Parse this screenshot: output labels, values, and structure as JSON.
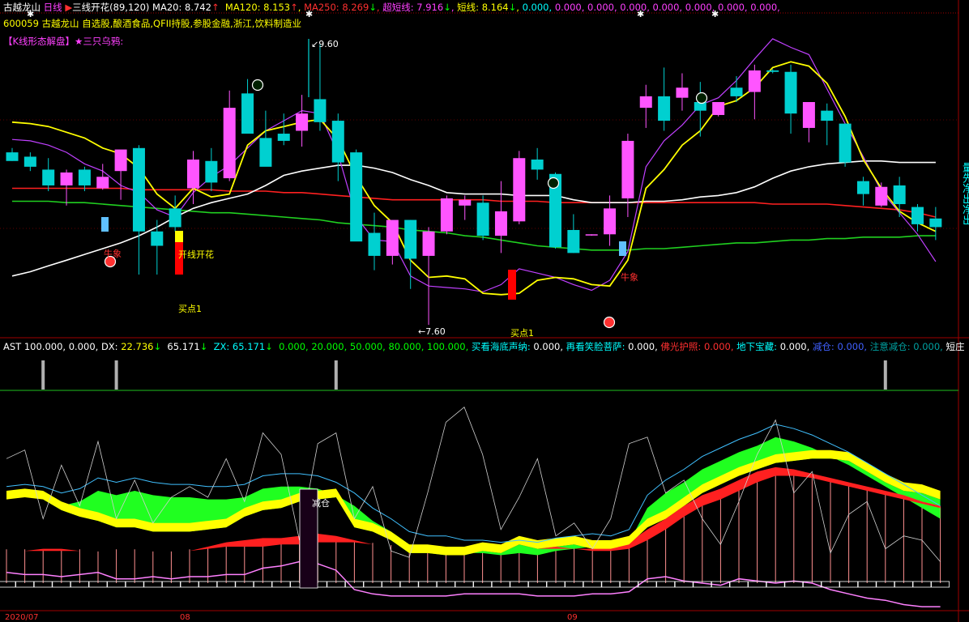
{
  "header1": {
    "name": "古越龙山",
    "period": "日线",
    "indicator": "三线开花",
    "params": "(89,120)",
    "ma20_label": "MA20:",
    "ma20": "8.742",
    "ma120_label": "MA120:",
    "ma120": "8.153",
    "ma250_label": "MA250:",
    "ma250": "8.269",
    "super_short_label": "超短线:",
    "super_short": "7.916",
    "short_label": "短线:",
    "short": "8.164",
    "tail_yellow": "0.000,",
    "tail_magenta": "0.000, 0.000, 0.000, 0.000, 0.000, 0.000, 0.000,"
  },
  "header2": {
    "code": "600059",
    "name": "古越龙山",
    "concepts": "自选股,酿酒食品,QFII持股,参股金融,浙江,饮料制造业"
  },
  "header3": {
    "bracket": "【K线形态解盘】",
    "pattern": "★三只乌鸦:"
  },
  "header4": {
    "p1": "AST 100.000, 0.000, DX:",
    "dx": "22.736",
    "dx2": "65.171",
    "zx_label": "ZX:",
    "zx": "65.171",
    "green_vals": "0.000, 20.000, 50.000, 80.000, 100.000,",
    "t1": "买看海底声纳:",
    "v1": "0.000,",
    "t2": "再看笑脸菩萨:",
    "v2": "0.000,",
    "t3": "佛光护照:",
    "v3": "0.000,",
    "t4": "地下宝藏:",
    "v4": "0.000,",
    "t5": "减仓:",
    "v5": "0.000,",
    "t6": "注意减仓:",
    "v6": "0.000,",
    "t7": "短庄"
  },
  "annotations": {
    "high": "9.60",
    "low": "7.60",
    "kaihua": "开线开花",
    "buy1a": "买点1",
    "buy1b": "买点1",
    "niu1": "牛象",
    "niu2": "牛象",
    "jiancang": "减仓",
    "right_edge": "量先净出净出",
    "bottom_left": "2020/07",
    "bottom_mid1": "08",
    "bottom_mid2": "09"
  },
  "colors": {
    "bull": "#ff55ff",
    "bear": "#00d0d0",
    "ma20": "#ffffff",
    "ma120": "#ff2020",
    "ma250": "#20d020",
    "super_short": "#ffff00",
    "short": "#c040ff",
    "white_text": "#ffffff",
    "yellow_text": "#ffff00",
    "magenta_text": "#ff40ff",
    "cyan_text": "#00ffff",
    "green_text": "#00ff00",
    "red_text": "#ff3030",
    "blue_text": "#4060ff"
  },
  "chart_data": [
    {
      "type": "candlestick",
      "ylim": [
        7.6,
        9.6
      ],
      "candles": [
        {
          "o": 8.85,
          "h": 8.88,
          "l": 8.79,
          "c": 8.79
        },
        {
          "o": 8.82,
          "h": 8.85,
          "l": 8.72,
          "c": 8.75
        },
        {
          "o": 8.73,
          "h": 8.81,
          "l": 8.58,
          "c": 8.62
        },
        {
          "o": 8.62,
          "h": 8.73,
          "l": 8.48,
          "c": 8.71
        },
        {
          "o": 8.73,
          "h": 8.75,
          "l": 8.58,
          "c": 8.62
        },
        {
          "o": 8.6,
          "h": 8.77,
          "l": 8.59,
          "c": 8.68
        },
        {
          "o": 8.72,
          "h": 8.8,
          "l": 8.52,
          "c": 8.87
        },
        {
          "o": 8.88,
          "h": 8.9,
          "l": 8.0,
          "c": 8.3
        },
        {
          "o": 8.3,
          "h": 8.38,
          "l": 8.0,
          "c": 8.2
        },
        {
          "o": 8.46,
          "h": 8.55,
          "l": 8.3,
          "c": 8.33
        },
        {
          "o": 8.6,
          "h": 8.86,
          "l": 8.49,
          "c": 8.8
        },
        {
          "o": 8.79,
          "h": 8.88,
          "l": 8.58,
          "c": 8.64
        },
        {
          "o": 8.67,
          "h": 9.28,
          "l": 8.65,
          "c": 9.16
        },
        {
          "o": 9.26,
          "h": 9.36,
          "l": 8.99,
          "c": 8.98
        },
        {
          "o": 8.95,
          "h": 9.14,
          "l": 8.8,
          "c": 8.75
        },
        {
          "o": 8.98,
          "h": 9.12,
          "l": 8.9,
          "c": 8.93
        },
        {
          "o": 9.0,
          "h": 9.25,
          "l": 8.89,
          "c": 9.12
        },
        {
          "o": 9.22,
          "h": 9.6,
          "l": 9.0,
          "c": 9.06
        },
        {
          "o": 9.07,
          "h": 9.12,
          "l": 8.65,
          "c": 8.78
        },
        {
          "o": 8.85,
          "h": 8.87,
          "l": 8.25,
          "c": 8.23
        },
        {
          "o": 8.29,
          "h": 8.43,
          "l": 8.03,
          "c": 8.13
        },
        {
          "o": 8.13,
          "h": 8.37,
          "l": 8.07,
          "c": 8.38
        },
        {
          "o": 8.38,
          "h": 8.38,
          "l": 7.9,
          "c": 8.11
        },
        {
          "o": 8.13,
          "h": 8.33,
          "l": 7.65,
          "c": 8.3
        },
        {
          "o": 8.3,
          "h": 8.55,
          "l": 8.28,
          "c": 8.53
        },
        {
          "o": 8.48,
          "h": 8.55,
          "l": 8.38,
          "c": 8.52
        },
        {
          "o": 8.5,
          "h": 8.55,
          "l": 8.24,
          "c": 8.27
        },
        {
          "o": 8.27,
          "h": 8.65,
          "l": 8.15,
          "c": 8.44
        },
        {
          "o": 8.37,
          "h": 8.86,
          "l": 8.35,
          "c": 8.81
        },
        {
          "o": 8.8,
          "h": 8.88,
          "l": 8.66,
          "c": 8.73
        },
        {
          "o": 8.7,
          "h": 8.71,
          "l": 8.18,
          "c": 8.19
        },
        {
          "o": 8.31,
          "h": 8.42,
          "l": 8.15,
          "c": 8.15
        },
        {
          "o": 8.28,
          "h": 8.28,
          "l": 8.27,
          "c": 8.28
        },
        {
          "o": 8.28,
          "h": 8.55,
          "l": 8.2,
          "c": 8.46
        },
        {
          "o": 8.53,
          "h": 8.98,
          "l": 8.4,
          "c": 8.93
        },
        {
          "o": 9.16,
          "h": 9.32,
          "l": 9.02,
          "c": 9.24
        },
        {
          "o": 9.24,
          "h": 9.44,
          "l": 9.0,
          "c": 9.07
        },
        {
          "o": 9.23,
          "h": 9.4,
          "l": 9.14,
          "c": 9.3
        },
        {
          "o": 9.2,
          "h": 9.34,
          "l": 8.96,
          "c": 9.14
        },
        {
          "o": 9.11,
          "h": 9.2,
          "l": 9.1,
          "c": 9.2
        },
        {
          "o": 9.3,
          "h": 9.38,
          "l": 9.2,
          "c": 9.24
        },
        {
          "o": 9.27,
          "h": 9.46,
          "l": 9.08,
          "c": 9.42
        },
        {
          "o": 9.42,
          "h": 9.43,
          "l": 9.4,
          "c": 9.41
        },
        {
          "o": 9.41,
          "h": 9.46,
          "l": 8.98,
          "c": 9.12
        },
        {
          "o": 9.02,
          "h": 9.19,
          "l": 8.92,
          "c": 9.2
        },
        {
          "o": 9.14,
          "h": 9.19,
          "l": 8.9,
          "c": 9.07
        },
        {
          "o": 9.05,
          "h": 9.05,
          "l": 8.75,
          "c": 8.78
        },
        {
          "o": 8.65,
          "h": 8.68,
          "l": 8.48,
          "c": 8.56
        },
        {
          "o": 8.48,
          "h": 8.64,
          "l": 8.47,
          "c": 8.61
        },
        {
          "o": 8.62,
          "h": 8.68,
          "l": 8.4,
          "c": 8.49
        },
        {
          "o": 8.47,
          "h": 8.49,
          "l": 8.3,
          "c": 8.35
        },
        {
          "o": 8.39,
          "h": 8.47,
          "l": 8.24,
          "c": 8.33
        }
      ],
      "ma20": [
        7.99,
        8.02,
        8.06,
        8.1,
        8.14,
        8.18,
        8.22,
        8.27,
        8.33,
        8.4,
        8.46,
        8.5,
        8.53,
        8.56,
        8.62,
        8.69,
        8.72,
        8.74,
        8.76,
        8.76,
        8.74,
        8.71,
        8.66,
        8.62,
        8.57,
        8.56,
        8.56,
        8.56,
        8.55,
        8.55,
        8.55,
        8.52,
        8.5,
        8.5,
        8.5,
        8.51,
        8.51,
        8.52,
        8.54,
        8.55,
        8.57,
        8.61,
        8.67,
        8.72,
        8.75,
        8.77,
        8.78,
        8.79,
        8.79,
        8.78,
        8.78,
        8.78
      ],
      "ma120": [
        8.6,
        8.6,
        8.6,
        8.6,
        8.6,
        8.6,
        8.6,
        8.59,
        8.59,
        8.59,
        8.59,
        8.59,
        8.58,
        8.58,
        8.58,
        8.57,
        8.57,
        8.56,
        8.55,
        8.54,
        8.53,
        8.52,
        8.52,
        8.52,
        8.52,
        8.52,
        8.52,
        8.51,
        8.51,
        8.51,
        8.5,
        8.5,
        8.5,
        8.5,
        8.5,
        8.5,
        8.5,
        8.5,
        8.5,
        8.5,
        8.5,
        8.5,
        8.49,
        8.49,
        8.49,
        8.49,
        8.48,
        8.47,
        8.46,
        8.45,
        8.43,
        8.4
      ],
      "ma250": [
        8.51,
        8.51,
        8.51,
        8.5,
        8.5,
        8.49,
        8.48,
        8.47,
        8.46,
        8.45,
        8.44,
        8.43,
        8.43,
        8.42,
        8.41,
        8.4,
        8.39,
        8.38,
        8.36,
        8.35,
        8.34,
        8.33,
        8.31,
        8.3,
        8.29,
        8.27,
        8.26,
        8.24,
        8.22,
        8.2,
        8.19,
        8.18,
        8.17,
        8.17,
        8.17,
        8.18,
        8.18,
        8.19,
        8.2,
        8.21,
        8.22,
        8.22,
        8.23,
        8.24,
        8.24,
        8.25,
        8.25,
        8.26,
        8.26,
        8.26,
        8.27,
        8.27
      ],
      "super_short": [
        9.06,
        9.05,
        9.03,
        8.99,
        8.95,
        8.88,
        8.84,
        8.74,
        8.56,
        8.46,
        8.6,
        8.54,
        8.56,
        8.9,
        9.0,
        9.03,
        9.06,
        9.08,
        8.94,
        8.68,
        8.48,
        8.36,
        8.1,
        7.98,
        7.99,
        7.97,
        7.87,
        7.86,
        7.87,
        7.96,
        7.98,
        7.97,
        7.93,
        7.92,
        8.1,
        8.6,
        8.73,
        8.9,
        9.0,
        9.17,
        9.21,
        9.3,
        9.44,
        9.48,
        9.45,
        9.33,
        9.1,
        8.8,
        8.6,
        8.44,
        8.36,
        8.3
      ],
      "short": [
        8.94,
        8.93,
        8.9,
        8.85,
        8.77,
        8.72,
        8.62,
        8.57,
        8.45,
        8.4,
        8.57,
        8.68,
        8.76,
        8.88,
        9.0,
        9.07,
        9.14,
        9.12,
        8.84,
        8.4,
        8.24,
        8.23,
        7.99,
        7.92,
        7.91,
        7.9,
        7.88,
        7.93,
        8.04,
        8.01,
        7.98,
        7.93,
        7.89,
        7.96,
        8.16,
        8.75,
        8.93,
        9.04,
        9.18,
        9.23,
        9.35,
        9.5,
        9.64,
        9.58,
        9.53,
        9.29,
        9.05,
        8.82,
        8.58,
        8.43,
        8.28,
        8.09
      ]
    },
    {
      "type": "area",
      "ylim": [
        0,
        100
      ],
      "ref_lines": [
        20,
        50,
        80,
        100
      ],
      "x_count": 52,
      "green_band": {
        "upper": [
          39,
          40,
          39,
          34,
          31,
          29,
          26,
          26,
          24,
          24,
          24,
          25,
          26,
          31,
          34,
          35,
          38,
          39,
          40,
          26,
          24,
          20,
          14,
          14,
          13,
          13,
          15,
          14,
          18,
          16,
          17,
          18,
          16,
          16,
          18,
          26,
          30,
          36,
          42,
          46,
          50,
          53,
          56,
          57,
          58,
          58,
          57,
          52,
          47,
          43,
          42,
          39
        ],
        "lower": [
          39,
          40,
          39,
          36,
          38,
          43,
          41,
          43,
          41,
          40,
          40,
          39,
          39,
          40,
          44,
          45,
          45,
          44,
          41,
          36,
          29,
          24,
          18,
          16,
          16,
          14,
          14,
          13,
          14,
          13,
          15,
          16,
          17,
          16,
          19,
          35,
          42,
          47,
          53,
          57,
          61,
          64,
          68,
          66,
          63,
          59,
          55,
          50,
          45,
          40,
          35,
          30
        ]
      },
      "red_band": {
        "upper": [
          15,
          15,
          16,
          16,
          15,
          14,
          15,
          15,
          14,
          14,
          15,
          17,
          19,
          20,
          21,
          21,
          22,
          23,
          22,
          20,
          18,
          17,
          16,
          16,
          15,
          14,
          14,
          14,
          15,
          16,
          17,
          16,
          16,
          17,
          19,
          25,
          30,
          36,
          41,
          44,
          48,
          52,
          54,
          53,
          51,
          49,
          47,
          45,
          43,
          41,
          38,
          36
        ],
        "lower": [
          15,
          15,
          15,
          15,
          15,
          14,
          15,
          15,
          14,
          14,
          15,
          16,
          17,
          17,
          17,
          18,
          18,
          19,
          19,
          19,
          18,
          17,
          16,
          16,
          15,
          14,
          14,
          14,
          15,
          16,
          16,
          16,
          15,
          15,
          16,
          20,
          25,
          31,
          36,
          39,
          43,
          47,
          50,
          50,
          49,
          47,
          45,
          43,
          41,
          39,
          37,
          35
        ]
      },
      "white_line": [
        58,
        62,
        30,
        55,
        36,
        66,
        30,
        48,
        28,
        40,
        45,
        40,
        58,
        38,
        70,
        60,
        20,
        65,
        70,
        30,
        45,
        15,
        12,
        42,
        75,
        82,
        60,
        25,
        40,
        58,
        22,
        28,
        16,
        30,
        65,
        68,
        42,
        48,
        30,
        18,
        38,
        60,
        76,
        42,
        52,
        14,
        32,
        38,
        16,
        22,
        20,
        10
      ],
      "pink_line": [
        5,
        4,
        4,
        3,
        4,
        5,
        2,
        2,
        3,
        2,
        3,
        3,
        4,
        4,
        7,
        8,
        10,
        9,
        6,
        -3,
        -5,
        -6,
        -6,
        -6,
        -6,
        -5,
        -5,
        -5,
        -5,
        -6,
        -6,
        -6,
        -5,
        -5,
        -4,
        2,
        3,
        1,
        0,
        -1,
        2,
        1,
        0,
        1,
        0,
        -3,
        -5,
        -7,
        -8,
        -10,
        -11,
        -11
      ],
      "markers_top": [
        2,
        6,
        18,
        48
      ]
    }
  ]
}
